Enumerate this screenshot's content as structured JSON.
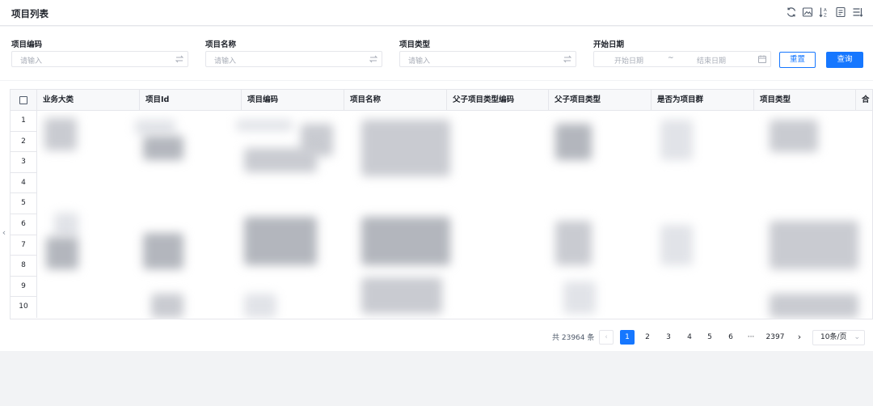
{
  "header": {
    "title": "项目列表",
    "tools": [
      "refresh-icon",
      "image-icon",
      "sort-alpha-icon",
      "export-icon",
      "column-settings-icon"
    ]
  },
  "filters": {
    "project_code": {
      "label": "项目编码",
      "placeholder": "请输入"
    },
    "project_name": {
      "label": "项目名称",
      "placeholder": "请输入"
    },
    "project_type": {
      "label": "项目类型",
      "placeholder": "请输入"
    },
    "start_date": {
      "label": "开始日期",
      "start_placeholder": "开始日期",
      "separator": "~",
      "end_placeholder": "结束日期"
    },
    "reset_label": "重置",
    "query_label": "查询"
  },
  "table": {
    "columns": [
      "业务大类",
      "项目Id",
      "项目编码",
      "项目名称",
      "父子项目类型编码",
      "父子项目类型",
      "是否为项目群",
      "项目类型",
      "合"
    ],
    "row_numbers": [
      "1",
      "2",
      "3",
      "4",
      "5",
      "6",
      "7",
      "8",
      "9",
      "10"
    ]
  },
  "pagination": {
    "total": "共 23964 条",
    "pages": [
      "1",
      "2",
      "3",
      "4",
      "5",
      "6"
    ],
    "ellipsis": "···",
    "last_page": "2397",
    "prev": "‹",
    "next": "›",
    "page_size": "10条/页"
  },
  "colors": {
    "primary": "#1677ff",
    "border": "#e5e6eb",
    "header_bg": "#f7f8fa",
    "page_bg": "#f2f3f5"
  }
}
